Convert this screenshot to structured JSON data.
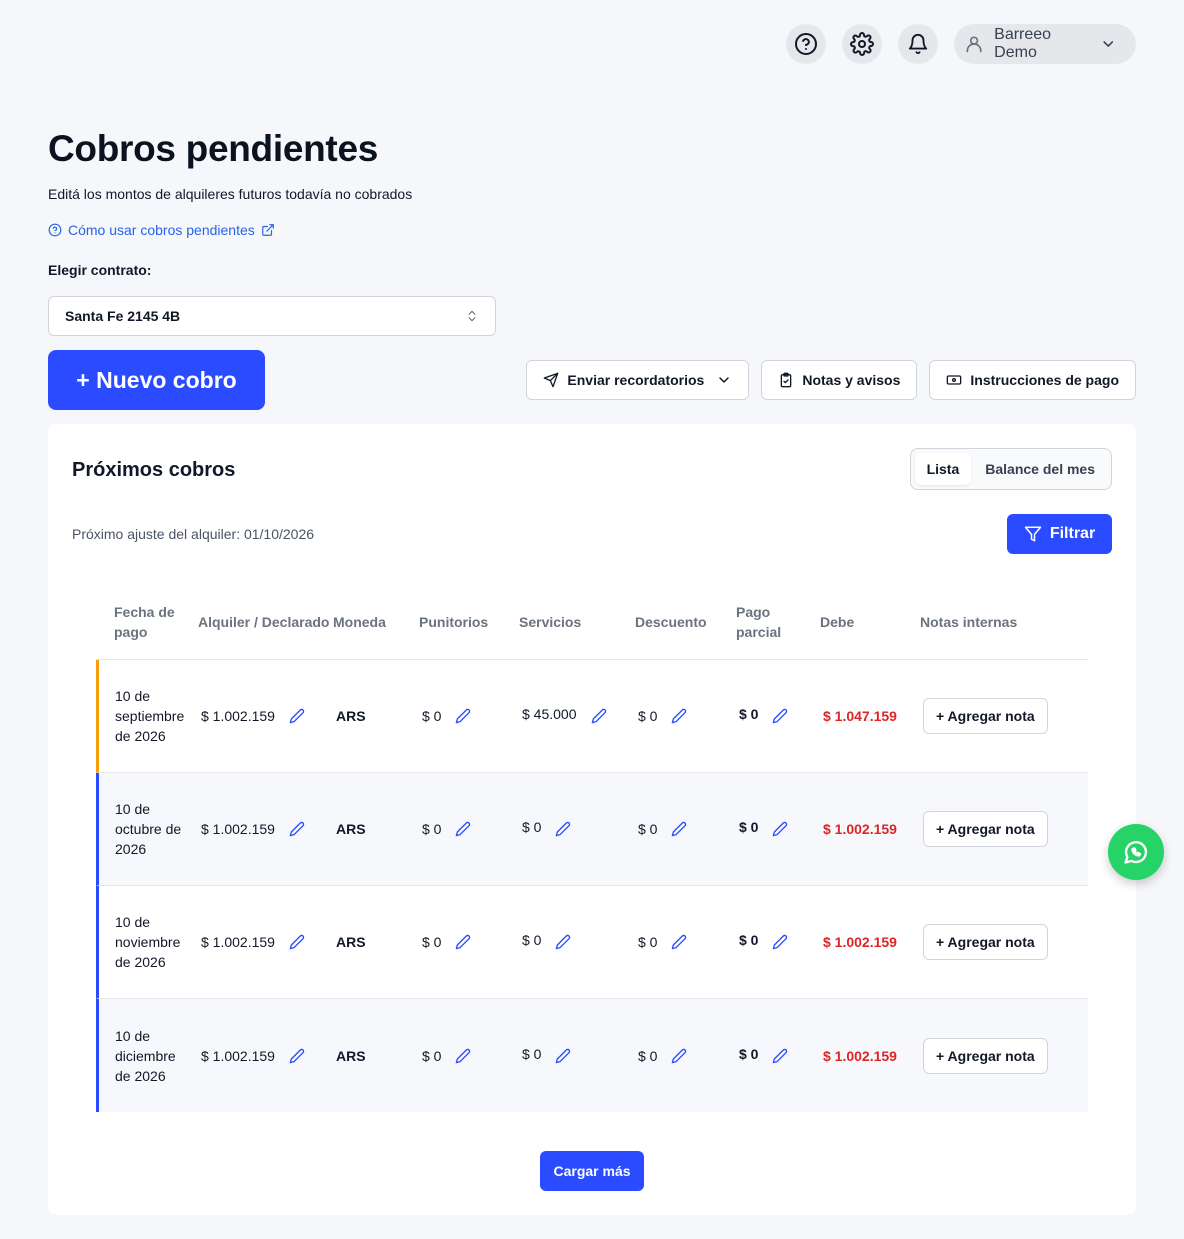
{
  "topbar": {
    "user_name": "Barreeo Demo"
  },
  "header": {
    "title": "Cobros pendientes",
    "subtitle": "Editá los montos de alquileres futuros todavía no cobrados",
    "help_link": "Cómo usar cobros pendientes",
    "contract_label": "Elegir contrato:",
    "contract_value": "Santa Fe 2145 4B"
  },
  "toolbar": {
    "new_button": "+ Nuevo cobro",
    "send_reminders": "Enviar recordatorios",
    "notes": "Notas y avisos",
    "payment_instructions": "Instrucciones de pago"
  },
  "card": {
    "title": "Próximos cobros",
    "tabs": [
      "Lista",
      "Balance del mes"
    ],
    "adjust_text": "Próximo ajuste del alquiler: 01/10/2026",
    "filter_label": "Filtrar",
    "load_more": "Cargar más"
  },
  "table": {
    "headers": [
      "Fecha de pago",
      "Alquiler / Declarado",
      "Moneda",
      "Punitorios",
      "Servicios",
      "Descuento",
      "Pago parcial",
      "Debe",
      "Notas internas"
    ],
    "note_button": "+ Agregar nota",
    "rows": [
      {
        "date": "10 de septiembre de 2026",
        "rent": "$ 1.002.159",
        "currency": "ARS",
        "penalty": "$ 0",
        "services": "$ 45.000",
        "discount": "$ 0",
        "partial": "$ 0",
        "owed": "$ 1.047.159"
      },
      {
        "date": "10 de octubre de 2026",
        "rent": "$ 1.002.159",
        "currency": "ARS",
        "penalty": "$ 0",
        "services": "$ 0",
        "discount": "$ 0",
        "partial": "$ 0",
        "owed": "$ 1.002.159"
      },
      {
        "date": "10 de noviembre de 2026",
        "rent": "$ 1.002.159",
        "currency": "ARS",
        "penalty": "$ 0",
        "services": "$ 0",
        "discount": "$ 0",
        "partial": "$ 0",
        "owed": "$ 1.002.159"
      },
      {
        "date": "10 de diciembre de 2026",
        "rent": "$ 1.002.159",
        "currency": "ARS",
        "penalty": "$ 0",
        "services": "$ 0",
        "discount": "$ 0",
        "partial": "$ 0",
        "owed": "$ 1.002.159"
      }
    ]
  },
  "colors": {
    "primary": "#2a4bff",
    "first_row_accent": "#f59e0b",
    "owed": "#dc2626",
    "whatsapp": "#25d366"
  }
}
